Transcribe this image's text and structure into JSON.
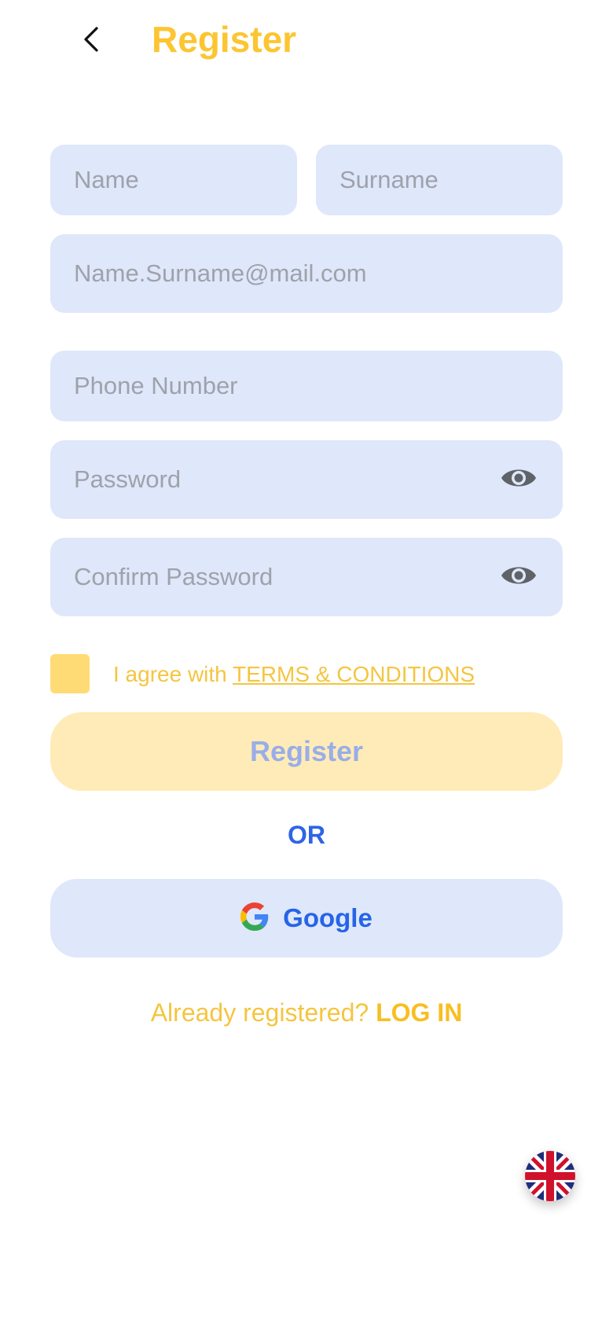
{
  "header": {
    "title": "Register",
    "back_icon": "chevron-left-icon"
  },
  "form": {
    "name_placeholder": "Name",
    "surname_placeholder": "Surname",
    "email_placeholder": "Name.Surname@mail.com",
    "phone_placeholder": "Phone Number",
    "password_placeholder": "Password",
    "confirm_password_placeholder": "Confirm Password",
    "eye_icon": "eye-icon"
  },
  "agreement": {
    "prefix": "I agree with ",
    "terms_link": "TERMS & CONDITIONS"
  },
  "register_button": {
    "label": "Register"
  },
  "divider": {
    "text": "OR"
  },
  "google_button": {
    "label": "Google",
    "icon": "google-logo-icon"
  },
  "login": {
    "prompt": "Already registered? ",
    "link": "LOG IN"
  },
  "language": {
    "icon": "uk-flag-icon"
  },
  "colors": {
    "accent": "#FCC531",
    "field_bg": "#DFE7FA",
    "primary_blue": "#2E64E6",
    "button_disabled_bg": "#FFEBB7"
  }
}
